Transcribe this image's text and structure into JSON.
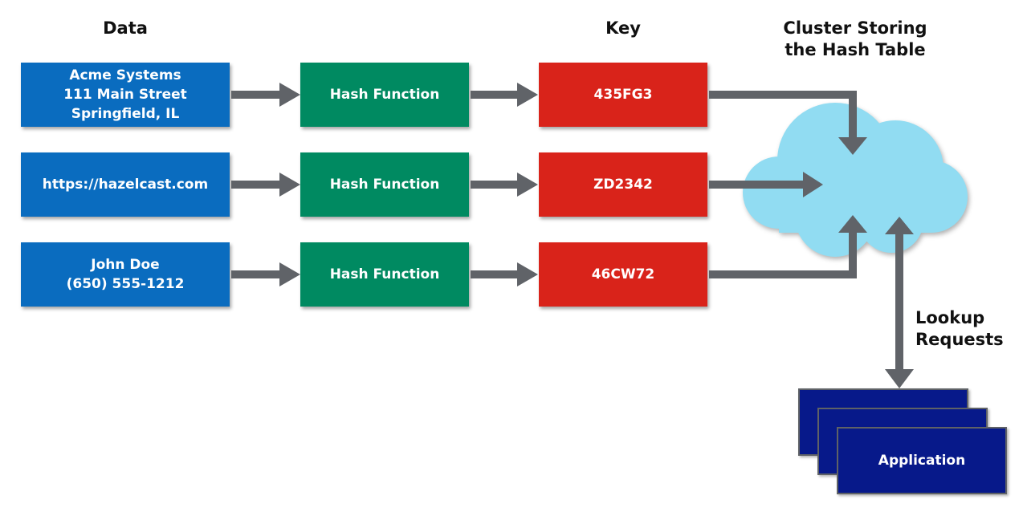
{
  "headers": {
    "data": "Data",
    "key": "Key",
    "cluster": "Cluster Storing\nthe Hash Table",
    "lookup": "Lookup\nRequests"
  },
  "rows": [
    {
      "data": "Acme Systems\n111 Main Street\nSpringfield, IL",
      "hash": "Hash Function",
      "key": "435FG3"
    },
    {
      "data": "https://hazelcast.com",
      "hash": "Hash Function",
      "key": "ZD2342"
    },
    {
      "data": "John Doe\n(650) 555-1212",
      "hash": "Hash Function",
      "key": "46CW72"
    }
  ],
  "application": {
    "label": "Application"
  },
  "colors": {
    "data_box": "#0a6cbf",
    "hash_box": "#008a61",
    "key_box": "#d9231a",
    "cloud": "#91dcf2",
    "arrow": "#606368",
    "application_box": "#07198a"
  }
}
